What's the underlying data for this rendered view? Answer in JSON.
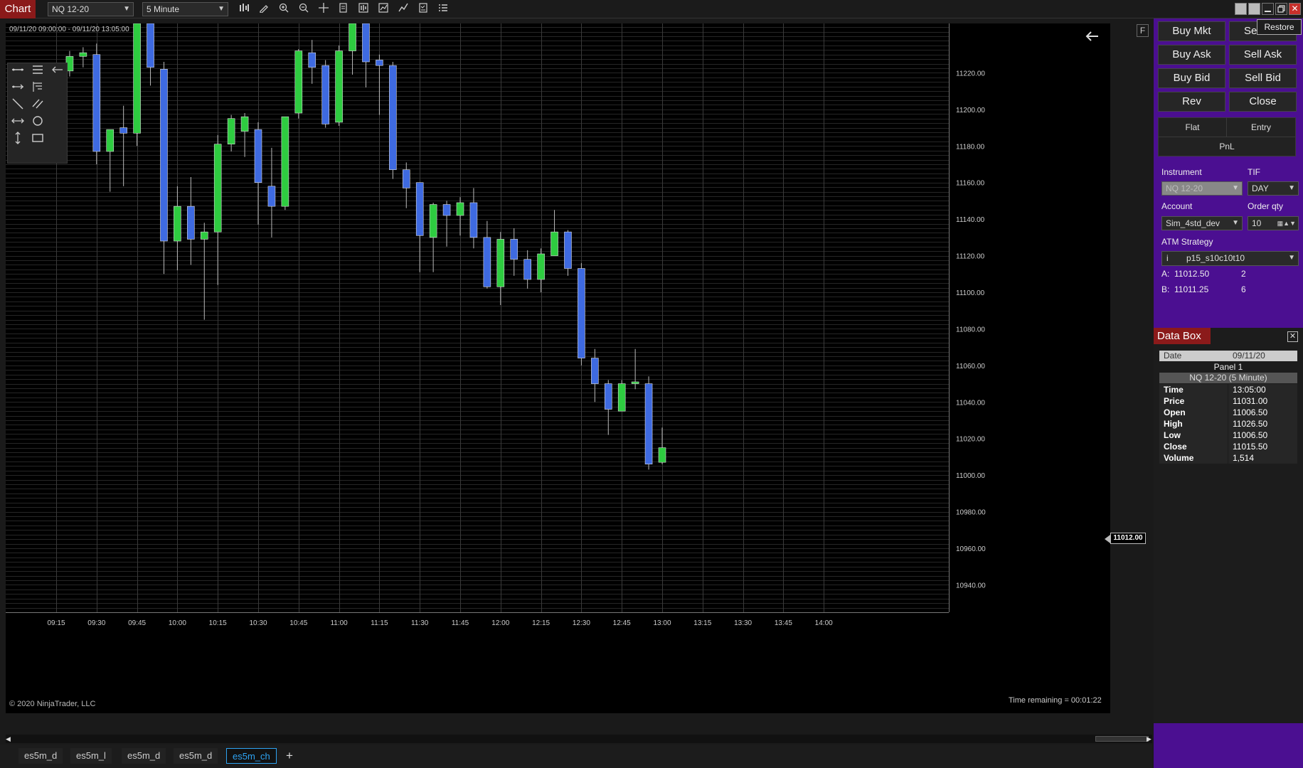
{
  "toolbar": {
    "app_title": "Chart",
    "instrument": "NQ 12-20",
    "interval": "5 Minute",
    "tooltip": "Restore"
  },
  "chart": {
    "date_range": "09/11/20 09:00:00 - 09/11/20 13:05:00",
    "copyright": "© 2020 NinjaTrader, LLC",
    "time_remaining": "Time remaining = 00:01:22",
    "f_badge": "F",
    "current_price_label": "11012.00"
  },
  "chart_data": {
    "type": "candlestick",
    "x_ticks": [
      "09:15",
      "09:30",
      "09:45",
      "10:00",
      "10:15",
      "10:30",
      "10:45",
      "11:00",
      "11:15",
      "11:30",
      "11:45",
      "12:00",
      "12:15",
      "12:30",
      "12:45",
      "13:00",
      "13:15",
      "13:30",
      "13:45",
      "14:00"
    ],
    "y_ticks": [
      10940,
      10960,
      10980,
      11000,
      11020,
      11040,
      11060,
      11080,
      11100,
      11120,
      11140,
      11160,
      11180,
      11200,
      11220
    ],
    "y_tick_labels": [
      "10940.00",
      "10960.00",
      "10980.00",
      "11000.00",
      "11020.00",
      "11040.00",
      "11060.00",
      "11080.00",
      "11100.00",
      "11120.00",
      "11140.00",
      "11160.00",
      "11180.00",
      "11200.00",
      "11220.00"
    ],
    "ylim": [
      10925,
      11247
    ],
    "colors": {
      "up": "#2ecc40",
      "down": "#3e6ae1",
      "wick": "#bbbbbb",
      "grid": "#3a3a3a"
    },
    "candles": [
      {
        "t": "09:10",
        "o": 11218,
        "h": 11225,
        "l": 11215,
        "c": 11220
      },
      {
        "t": "09:15",
        "o": 11221,
        "h": 11225,
        "l": 11218,
        "c": 11219
      },
      {
        "t": "09:20",
        "o": 11221,
        "h": 11232,
        "l": 11218,
        "c": 11229
      },
      {
        "t": "09:25",
        "o": 11229,
        "h": 11234,
        "l": 11223,
        "c": 11231
      },
      {
        "t": "09:30",
        "o": 11230,
        "h": 11236,
        "l": 11170,
        "c": 11177
      },
      {
        "t": "09:35",
        "o": 11177,
        "h": 11188,
        "l": 11155,
        "c": 11189
      },
      {
        "t": "09:40",
        "o": 11190,
        "h": 11202,
        "l": 11158,
        "c": 11187
      },
      {
        "t": "09:45",
        "o": 11187,
        "h": 11248,
        "l": 11180,
        "c": 11248
      },
      {
        "t": "09:50",
        "o": 11248,
        "h": 11248,
        "l": 11213,
        "c": 11223
      },
      {
        "t": "09:55",
        "o": 11222,
        "h": 11226,
        "l": 11110,
        "c": 11128
      },
      {
        "t": "10:00",
        "o": 11128,
        "h": 11158,
        "l": 11112,
        "c": 11147
      },
      {
        "t": "10:05",
        "o": 11147,
        "h": 11163,
        "l": 11115,
        "c": 11129
      },
      {
        "t": "10:10",
        "o": 11129,
        "h": 11138,
        "l": 11085,
        "c": 11133
      },
      {
        "t": "10:15",
        "o": 11133,
        "h": 11186,
        "l": 11104,
        "c": 11181
      },
      {
        "t": "10:20",
        "o": 11181,
        "h": 11197,
        "l": 11177,
        "c": 11195
      },
      {
        "t": "10:25",
        "o": 11188,
        "h": 11198,
        "l": 11174,
        "c": 11196
      },
      {
        "t": "10:30",
        "o": 11189,
        "h": 11193,
        "l": 11137,
        "c": 11160
      },
      {
        "t": "10:35",
        "o": 11158,
        "h": 11179,
        "l": 11130,
        "c": 11147
      },
      {
        "t": "10:40",
        "o": 11147,
        "h": 11196,
        "l": 11145,
        "c": 11196
      },
      {
        "t": "10:45",
        "o": 11198,
        "h": 11233,
        "l": 11195,
        "c": 11232
      },
      {
        "t": "10:50",
        "o": 11231,
        "h": 11238,
        "l": 11214,
        "c": 11223
      },
      {
        "t": "10:55",
        "o": 11224,
        "h": 11227,
        "l": 11190,
        "c": 11192
      },
      {
        "t": "11:00",
        "o": 11193,
        "h": 11235,
        "l": 11191,
        "c": 11232
      },
      {
        "t": "11:05",
        "o": 11232,
        "h": 11249,
        "l": 11219,
        "c": 11248
      },
      {
        "t": "11:10",
        "o": 11248,
        "h": 11249,
        "l": 11212,
        "c": 11226
      },
      {
        "t": "11:15",
        "o": 11227,
        "h": 11230,
        "l": 11197,
        "c": 11224
      },
      {
        "t": "11:20",
        "o": 11224,
        "h": 11226,
        "l": 11162,
        "c": 11167
      },
      {
        "t": "11:25",
        "o": 11167,
        "h": 11171,
        "l": 11146,
        "c": 11157
      },
      {
        "t": "11:30",
        "o": 11160,
        "h": 11160,
        "l": 11111,
        "c": 11131
      },
      {
        "t": "11:35",
        "o": 11130,
        "h": 11149,
        "l": 11111,
        "c": 11148
      },
      {
        "t": "11:40",
        "o": 11148,
        "h": 11150,
        "l": 11125,
        "c": 11142
      },
      {
        "t": "11:45",
        "o": 11142,
        "h": 11152,
        "l": 11131,
        "c": 11149
      },
      {
        "t": "11:50",
        "o": 11149,
        "h": 11157,
        "l": 11124,
        "c": 11130
      },
      {
        "t": "11:55",
        "o": 11130,
        "h": 11139,
        "l": 11102,
        "c": 11103
      },
      {
        "t": "12:00",
        "o": 11103,
        "h": 11133,
        "l": 11093,
        "c": 11129
      },
      {
        "t": "12:05",
        "o": 11129,
        "h": 11135,
        "l": 11109,
        "c": 11118
      },
      {
        "t": "12:10",
        "o": 11118,
        "h": 11123,
        "l": 11102,
        "c": 11107
      },
      {
        "t": "12:15",
        "o": 11107,
        "h": 11124,
        "l": 11100,
        "c": 11121
      },
      {
        "t": "12:20",
        "o": 11120,
        "h": 11145,
        "l": 11120,
        "c": 11133
      },
      {
        "t": "12:25",
        "o": 11133,
        "h": 11134,
        "l": 11109,
        "c": 11113
      },
      {
        "t": "12:30",
        "o": 11113,
        "h": 11116,
        "l": 11060,
        "c": 11064
      },
      {
        "t": "12:35",
        "o": 11064,
        "h": 11069,
        "l": 11040,
        "c": 11050
      },
      {
        "t": "12:40",
        "o": 11050,
        "h": 11052,
        "l": 11022,
        "c": 11036
      },
      {
        "t": "12:45",
        "o": 11035,
        "h": 11052,
        "l": 11035,
        "c": 11050
      },
      {
        "t": "12:50",
        "o": 11050,
        "h": 11069,
        "l": 11047,
        "c": 11051
      },
      {
        "t": "12:55",
        "o": 11050,
        "h": 11054,
        "l": 11003,
        "c": 11006
      },
      {
        "t": "13:00",
        "o": 11007,
        "h": 11026,
        "l": 11006,
        "c": 11015
      }
    ]
  },
  "drawing_tools": [
    "line-icon",
    "horizontal-lines-icon",
    "arrow-left-tool-icon",
    "ray-icon",
    "fib-icon",
    "diagonal-line-icon",
    "parallel-lines-icon",
    "extended-line-icon",
    "ellipse-icon",
    "vertical-arrow-icon",
    "rectangle-icon"
  ],
  "order_panel": {
    "buttons": [
      "Buy Mkt",
      "Sell Mkt",
      "Buy Ask",
      "Sell Ask",
      "Buy Bid",
      "Sell Bid",
      "Rev",
      "Close"
    ],
    "buy_mkt_label": "Buy Mkt",
    "sell_mkt_visible": "Se",
    "flat": "Flat",
    "entry": "Entry",
    "pnl": "PnL",
    "instrument_label": "Instrument",
    "instrument_value": "NQ 12-20",
    "tif_label": "TIF",
    "tif_value": "DAY",
    "account_label": "Account",
    "account_value": "Sim_4std_dev",
    "order_qty_label": "Order qty",
    "order_qty_value": "10",
    "atm_label": "ATM Strategy",
    "atm_info": "i",
    "atm_value": "p15_s10c10t10",
    "ask_label": "A:",
    "ask_price": "11012.50",
    "ask_size": "2",
    "bid_label": "B:",
    "bid_price": "11011.25",
    "bid_size": "6"
  },
  "databox": {
    "title": "Data Box",
    "date_label": "Date",
    "date_value": "09/11/20",
    "panel": "Panel 1",
    "series": "NQ 12-20 (5 Minute)",
    "rows": [
      {
        "k": "Time",
        "v": "13:05:00"
      },
      {
        "k": "Price",
        "v": "11031.00"
      },
      {
        "k": "Open",
        "v": "11006.50"
      },
      {
        "k": "High",
        "v": "11026.50"
      },
      {
        "k": "Low",
        "v": "11006.50"
      },
      {
        "k": "Close",
        "v": "11015.50"
      },
      {
        "k": "Volume",
        "v": "1,514"
      }
    ]
  },
  "tabs": [
    {
      "label": "es5m_d",
      "active": false
    },
    {
      "label": "es5m_l",
      "active": false
    },
    {
      "label": "es5m_d",
      "active": false
    },
    {
      "label": "es5m_d",
      "active": false
    },
    {
      "label": "es5m_ch",
      "active": true
    }
  ],
  "tab_add": "+"
}
